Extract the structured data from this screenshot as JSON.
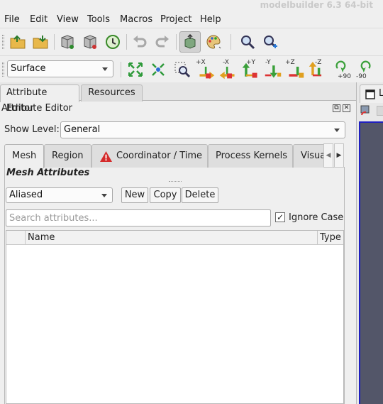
{
  "window": {
    "title": "modelbuilder 6.3 64-bit"
  },
  "menu": [
    "File",
    "Edit",
    "View",
    "Tools",
    "Macros",
    "Project",
    "Help"
  ],
  "toolbar1": {
    "icons": [
      "open-folder-icon",
      "save-folder-icon",
      "load-resource-icon",
      "remove-resource-icon",
      "history-clock-icon",
      "undo-icon",
      "redo-icon",
      "select-camera-icon",
      "color-palette-icon",
      "zoom-to-box-icon",
      "zoom-add-icon"
    ]
  },
  "representation": {
    "selected": "Surface"
  },
  "camera_buttons": {
    "reset_label": "",
    "labels": [
      "+X",
      "-X",
      "+Y",
      "-Y",
      "+Z",
      "-Z",
      "+90",
      "-90"
    ]
  },
  "dock": {
    "tabs": [
      "Attribute Editor",
      "Resources"
    ],
    "selected_tab": "Attribute Editor",
    "panel_title": "Attribute Editor"
  },
  "show_level": {
    "label": "Show Level:",
    "value": "General"
  },
  "inner_tabs": [
    "Mesh",
    "Region",
    "Coordinator / Time",
    "Process Kernels",
    "Visua"
  ],
  "section_title": "Mesh Attributes",
  "view_mode": {
    "value": "Aliased"
  },
  "buttons": {
    "new": "New",
    "copy": "Copy",
    "delete": "Delete"
  },
  "search": {
    "placeholder": "Search attributes...",
    "value": ""
  },
  "ignore_case": {
    "label": "Ignore Case",
    "checked": true,
    "check": "✓"
  },
  "table": {
    "columns": [
      "Name",
      "Type"
    ]
  },
  "right_pane": {
    "tab_label": "L"
  }
}
